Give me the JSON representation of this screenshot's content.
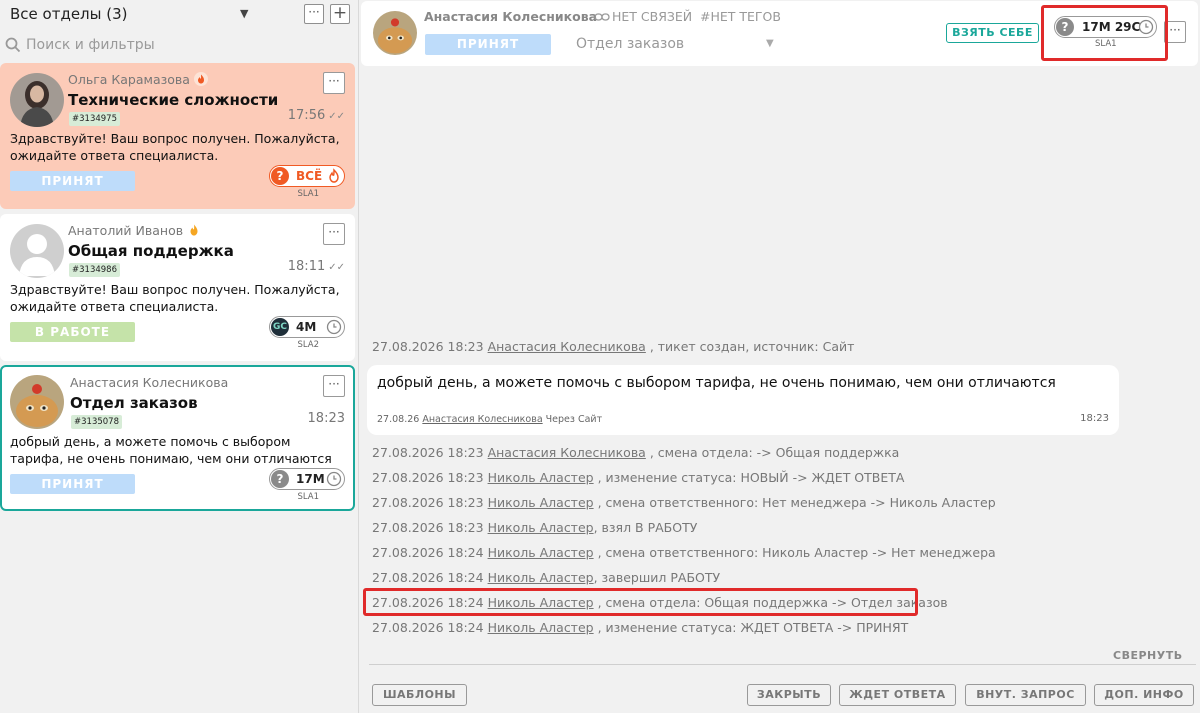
{
  "sidebar": {
    "title": "Все отделы (3)",
    "search_placeholder": "Поиск и фильтры",
    "more_label": "···",
    "add_label": "+",
    "cards": [
      {
        "name": "Ольга Карамазова",
        "topic": "Технические сложности",
        "ticket_id": "#3134975",
        "time": "17:56",
        "preview": "Здравствуйте! Ваш вопрос получен. Пожалуйста, ожидайте ответа специалиста.",
        "status": "ПРИНЯТ",
        "sla_value": "ВСЁ",
        "sla_label": "SLA1",
        "sla_icon": "question-icon",
        "sla_color": "#f05a24"
      },
      {
        "name": "Анатолий Иванов",
        "topic": "Общая поддержка",
        "ticket_id": "#3134986",
        "time": "18:11",
        "preview": "Здравствуйте! Ваш вопрос получен. Пожалуйста, ожидайте ответа специалиста.",
        "status": "В РАБОТЕ",
        "sla_value": "4М",
        "sla_label": "SLA2",
        "sla_icon": "gc-badge",
        "sla_badge_text": "GC"
      },
      {
        "name": "Анастасия Колесникова",
        "topic": "Отдел заказов",
        "ticket_id": "#3135078",
        "time": "18:23",
        "preview": "добрый день, а можете помочь с выбором тарифа, не очень понимаю, чем они отличаются",
        "status": "ПРИНЯТ",
        "sla_value": "17М",
        "sla_label": "SLA1",
        "sla_icon": "question-icon",
        "sla_color": "#8a8a8a"
      }
    ]
  },
  "chat": {
    "header": {
      "name": "Анастасия Колесникова",
      "links": "НЕТ СВЯЗЕЙ",
      "tags": "#НЕТ ТЕГОВ",
      "status": "ПРИНЯТ",
      "department": "Отдел заказов",
      "take_button": "ВЗЯТЬ СЕБЕ",
      "sla_value": "17М 29С",
      "sla_label": "SLA1",
      "more_label": "···"
    },
    "first_event": {
      "date": "27.08.2026 18:23",
      "user": "Анастасия Колесникова",
      "text": " , тикет создан, источник: Сайт"
    },
    "message": {
      "text": "добрый день, а можете помочь с выбором тарифа, не очень понимаю, чем они отличаются",
      "date": "27.08.26",
      "author": "Анастасия Колесникова",
      "source": "Через Сайт",
      "time": "18:23"
    },
    "events": [
      {
        "date": "27.08.2026 18:23",
        "user": "Анастасия Колесникова",
        "text": " , смена отдела: -> Общая поддержка"
      },
      {
        "date": "27.08.2026 18:23",
        "user": "Николь Аластер",
        "text": " , изменение статуса: НОВЫЙ -> ЖДЕТ ОТВЕТА"
      },
      {
        "date": "27.08.2026 18:23",
        "user": "Николь Аластер",
        "text": " , смена ответственного: Нет менеджера -> Николь Аластер"
      },
      {
        "date": "27.08.2026 18:23",
        "user": "Николь Аластер",
        "text": ", взял В РАБОТУ"
      },
      {
        "date": "27.08.2026 18:24",
        "user": "Николь Аластер",
        "text": " , смена ответственного: Николь Аластер -> Нет менеджера"
      },
      {
        "date": "27.08.2026 18:24",
        "user": "Николь Аластер",
        "text": ", завершил РАБОТУ"
      },
      {
        "date": "27.08.2026 18:24",
        "user": "Николь Аластер",
        "text": " , смена отдела: Общая поддержка -> Отдел заказов"
      },
      {
        "date": "27.08.2026 18:24",
        "user": "Николь Аластер",
        "text": " , изменение статуса: ЖДЕТ ОТВЕТА -> ПРИНЯТ"
      }
    ],
    "collapse": "СВЕРНУТЬ",
    "footer": {
      "templates": "ШАБЛОНЫ",
      "close": "ЗАКРЫТЬ",
      "wait": "ЖДЕТ ОТВЕТА",
      "internal": "ВНУТ. ЗАПРОС",
      "extra": "ДОП. ИНФО"
    }
  },
  "colors": {
    "accent": "#1aa79a",
    "status_blue": "#bedcfa",
    "status_green": "#c5e3a9",
    "urgent_card": "#fccbb8",
    "highlight": "#e02a2a"
  }
}
